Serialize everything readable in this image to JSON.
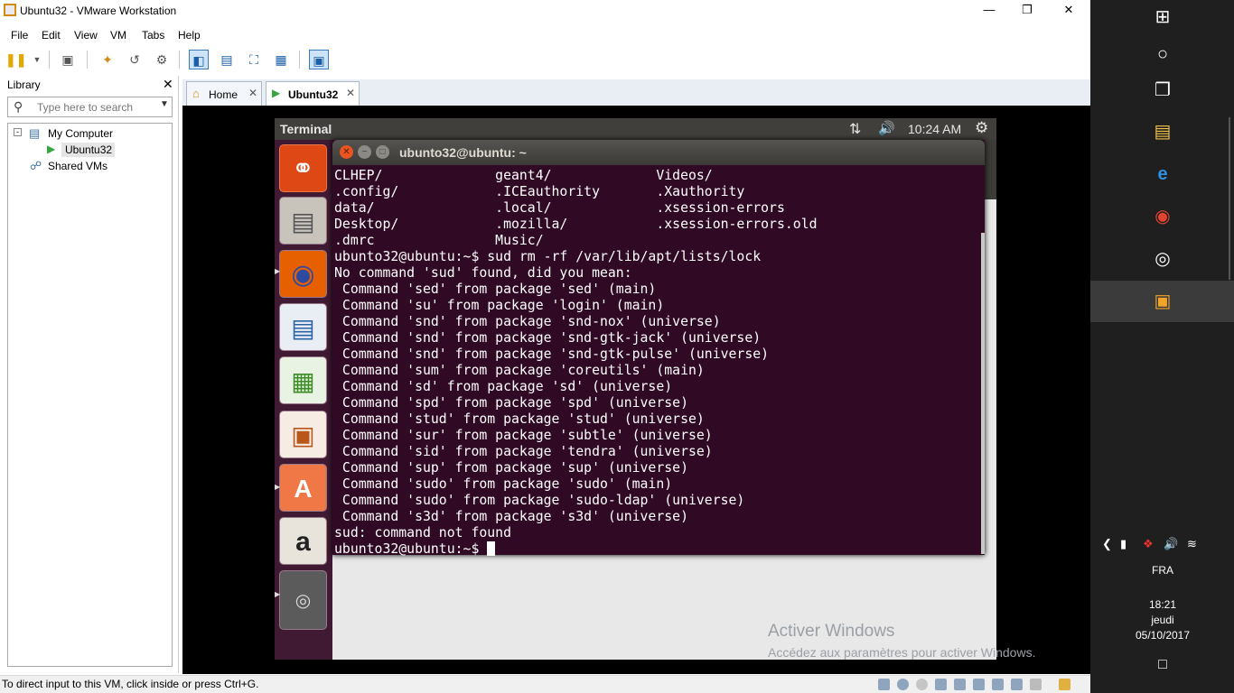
{
  "window": {
    "title": "Ubuntu32 - VMware Workstation"
  },
  "menu": [
    "File",
    "Edit",
    "View",
    "VM",
    "Tabs",
    "Help"
  ],
  "library": {
    "title": "Library",
    "search_placeholder": "Type here to search",
    "tree": [
      {
        "label": "My Computer"
      },
      {
        "label": "Ubuntu32"
      },
      {
        "label": "Shared VMs"
      }
    ]
  },
  "tabs": [
    {
      "label": "Home"
    },
    {
      "label": "Ubuntu32"
    }
  ],
  "ubuntu": {
    "bar_title": "Terminal",
    "clock": "10:24 AM",
    "terminal_title": "ubunto32@ubuntu: ~"
  },
  "terminal_lines": [
    "CLHEP/              geant4/             Videos/",
    ".config/            .ICEauthority       .Xauthority",
    "data/               .local/             .xsession-errors",
    "Desktop/            .mozilla/           .xsession-errors.old",
    ".dmrc               Music/",
    "ubunto32@ubuntu:~$ sud rm -rf /var/lib/apt/lists/lock",
    "No command 'sud' found, did you mean:",
    " Command 'sed' from package 'sed' (main)",
    " Command 'su' from package 'login' (main)",
    " Command 'snd' from package 'snd-nox' (universe)",
    " Command 'snd' from package 'snd-gtk-jack' (universe)",
    " Command 'snd' from package 'snd-gtk-pulse' (universe)",
    " Command 'sum' from package 'coreutils' (main)",
    " Command 'sd' from package 'sd' (universe)",
    " Command 'spd' from package 'spd' (universe)",
    " Command 'stud' from package 'stud' (universe)",
    " Command 'sur' from package 'subtle' (universe)",
    " Command 'sid' from package 'tendra' (universe)",
    " Command 'sup' from package 'sup' (universe)",
    " Command 'sudo' from package 'sudo' (main)",
    " Command 'sudo' from package 'sudo-ldap' (universe)",
    " Command 's3d' from package 's3d' (universe)",
    "sud: command not found"
  ],
  "prompt": "ubunto32@ubuntu:~$ ",
  "watermark": {
    "title": "Activer Windows",
    "subtitle": "Accédez aux paramètres pour activer Windows."
  },
  "status": "To direct input to this VM, click inside or press Ctrl+G.",
  "taskbar": {
    "lang": "FRA",
    "time": "18:21",
    "day": "jeudi",
    "date": "05/10/2017"
  }
}
